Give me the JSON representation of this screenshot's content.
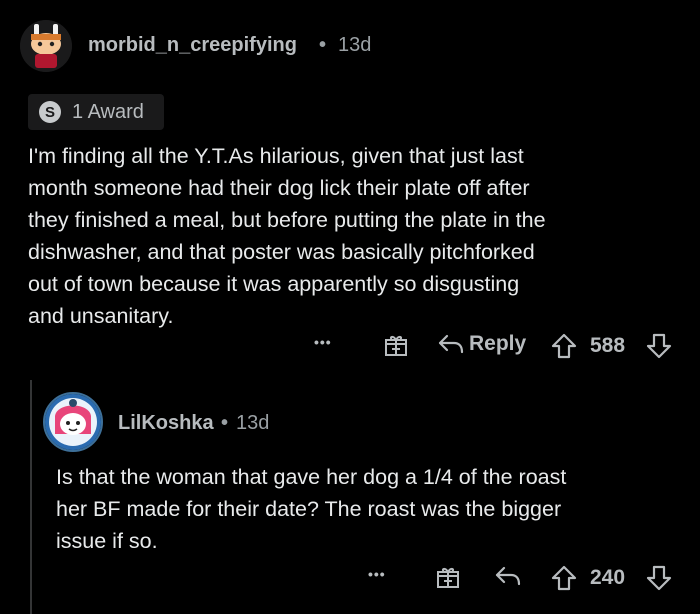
{
  "comment1": {
    "username": "morbid_n_creepifying",
    "separator": "•",
    "time": "13d",
    "award_label": "1 Award",
    "body": "I'm finding all the Y.T.As hilarious, given that just last\nmonth someone had their dog lick their plate off after\nthey finished a meal, but before putting the plate in the\ndishwasher, and that poster was basically pitchforked\nout of town because it was apparently so disgusting\nand unsanitary.",
    "actions": {
      "more": "•••",
      "reply_label": "Reply",
      "score": "588"
    }
  },
  "comment2": {
    "username": "LilKoshka",
    "separator": "•",
    "time": "13d",
    "body": "Is that the woman that gave her dog a 1/4 of the roast\nher BF made for their date? The roast was the bigger\nissue if so.",
    "actions": {
      "more": "•••",
      "score": "240"
    }
  },
  "colors": {
    "background": "#000000",
    "text": "#e8eaeb",
    "muted": "#9aa0a4",
    "thread_line": "#343536"
  }
}
